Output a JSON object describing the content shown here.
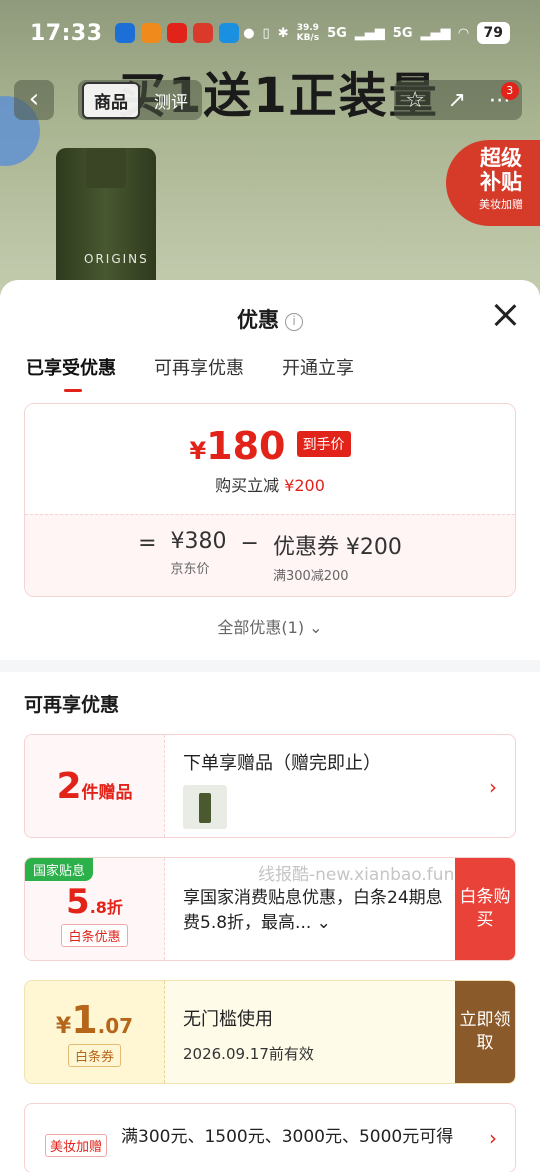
{
  "status_bar": {
    "time": "17:33",
    "net_speed_top": "39.9",
    "net_speed_unit": "KB/s",
    "signal_a": "5G",
    "signal_b": "5G",
    "battery": "79"
  },
  "product_header": {
    "promo_text": "买1送1正装量",
    "tabs": [
      "商品",
      "测评"
    ],
    "cart_count": "3",
    "bottle_label": "ORIGINS",
    "super_badge_line1": "超级",
    "super_badge_line2": "补贴",
    "super_badge_sub": "美妆加赠"
  },
  "sheet": {
    "title": "优惠",
    "tabs": [
      "已享受优惠",
      "可再享优惠",
      "开通立享"
    ],
    "price_card": {
      "currency": "¥",
      "final_price": "180",
      "final_tag": "到手价",
      "reduce_label": "购买立减",
      "reduce_value": "¥200",
      "equals": "=",
      "jd_price": "¥380",
      "jd_label": "京东价",
      "minus": "−",
      "coupon": "优惠券 ¥200",
      "coupon_rule": "满300减200"
    },
    "all_link": "全部优惠(1)",
    "section_title": "可再享优惠",
    "gift_offer": {
      "count": "2",
      "unit": "件赠品",
      "title": "下单享赠品（赠完即止）"
    },
    "gov_offer": {
      "tag": "国家贴息",
      "discount": "5",
      "discount_dec": ".8折",
      "sub_tag": "白条优惠",
      "desc": "享国家消费贴息优惠，白条24期息费5.8折，最高...",
      "button": "白条购买"
    },
    "watermark": "线报酷-new.xianbao.fun",
    "coupon_offer": {
      "currency": "¥",
      "amount": "1",
      "amount_dec": ".07",
      "sub_tag": "白条券",
      "title": "无门槛使用",
      "valid": "2026.09.17前有效",
      "button": "立即领取"
    },
    "beauty_offer": {
      "tag": "美妆加赠",
      "text": "满300元、1500元、3000元、5000元可得"
    }
  }
}
